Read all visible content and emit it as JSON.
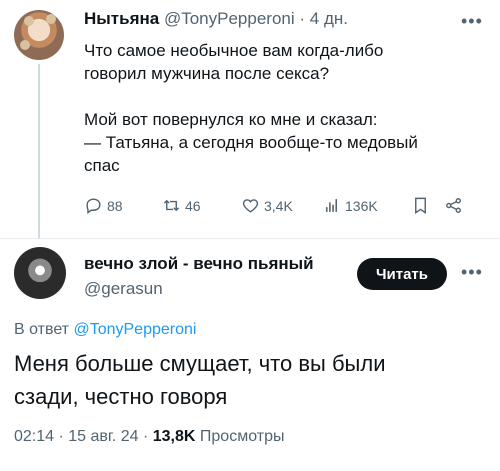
{
  "tweet1": {
    "author_name": "Нытьяна",
    "handle": "@TonyPepperoni",
    "separator": "·",
    "time": "4 дн.",
    "text": "Что самое необычное вам когда-либо\nговорил мужчина после секса?\n\nМой вот повернулся ко мне и сказал:\n— Татьяна, а сегодня вообще-то медовый\nспас",
    "more_icon": "more-icon",
    "actions": {
      "replies": "88",
      "retweets": "46",
      "likes": "3,4K",
      "views": "136K"
    }
  },
  "tweet2": {
    "author_name": "вечно злой - вечно пьяный",
    "handle": "@gerasun",
    "follow_label": "Читать",
    "reply_prefix": "В ответ",
    "reply_handle": "@TonyPepperoni",
    "text": "Меня больше смущает, что вы были\nсзади, честно говоря",
    "time": "02:14",
    "date": "15 авг. 24",
    "views_count": "13,8K",
    "views_label": "Просмотры"
  },
  "colors": {
    "link": "#1d9bf0",
    "muted": "#536471",
    "text": "#0f1419",
    "button_bg": "#0f1419"
  }
}
